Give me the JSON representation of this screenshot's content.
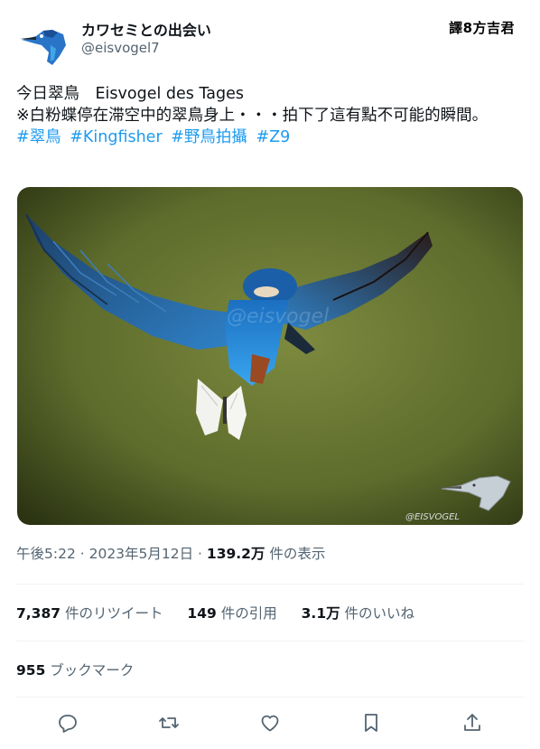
{
  "author": {
    "display_name": "カワセミとの出会い",
    "handle": "@eisvogel7"
  },
  "translator_badge": "譯8方吉君",
  "tweet": {
    "line1": "今日翠鳥　Eisvogel des Tages",
    "line2": "※白粉蝶停在滞空中的翠鳥身上・・・拍下了這有點不可能的瞬間。",
    "hashtags": [
      "#翠鳥",
      "#Kingfisher",
      "#野鳥拍攝",
      "#Z9"
    ]
  },
  "media": {
    "watermark_center": "@eisvogel",
    "watermark_corner": "@EISVOGEL"
  },
  "meta": {
    "time": "午後5:22",
    "sep1": " · ",
    "date": "2023年5月12日",
    "sep2": " · ",
    "views_count": "139.2万",
    "views_label": " 件の表示"
  },
  "stats": {
    "retweets_count": "7,387",
    "retweets_label": " 件のリツイート",
    "quotes_count": "149",
    "quotes_label": " 件の引用",
    "likes_count": "3.1万",
    "likes_label": " 件のいいね"
  },
  "bookmarks": {
    "count": "955",
    "label": " ブックマーク"
  },
  "actions": [
    "reply-icon",
    "retweet-icon",
    "like-icon",
    "bookmark-icon",
    "share-icon"
  ],
  "colors": {
    "link": "#1d9bf0",
    "secondary_text": "#536471",
    "divider": "#eff3f4"
  }
}
